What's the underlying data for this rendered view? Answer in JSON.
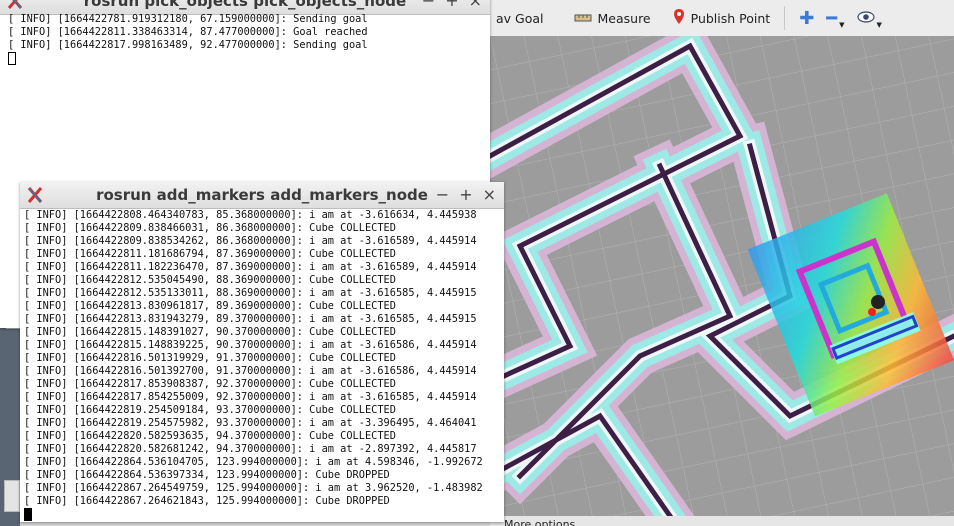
{
  "rviz": {
    "toolbar": [
      {
        "label": "av Goal",
        "icon": "nav-goal-icon"
      },
      {
        "label": "Measure",
        "icon": "ruler-icon"
      },
      {
        "label": "Publish Point",
        "icon": "map-pin-icon"
      }
    ],
    "status_text": "More options"
  },
  "term1": {
    "title": "rosrun pick_objects pick_objects_node",
    "lines": [
      "[ INFO] [1664422781.919312180, 67.159000000]: Sending goal",
      "[ INFO] [1664422811.338463314, 87.477000000]: Goal reached",
      "[ INFO] [1664422817.998163489, 92.477000000]: Sending goal"
    ]
  },
  "term2": {
    "title": "rosrun add_markers add_markers_node",
    "lines": [
      "[ INFO] [1664422808.464340783, 85.368000000]: i am at -3.616634, 4.445938",
      "[ INFO] [1664422809.838466031, 86.368000000]: Cube COLLECTED",
      "[ INFO] [1664422809.838534262, 86.368000000]: i am at -3.616589, 4.445914",
      "[ INFO] [1664422811.181686794, 87.369000000]: Cube COLLECTED",
      "[ INFO] [1664422811.182236470, 87.369000000]: i am at -3.616589, 4.445914",
      "[ INFO] [1664422812.535045490, 88.369000000]: Cube COLLECTED",
      "[ INFO] [1664422812.535133011, 88.369000000]: i am at -3.616585, 4.445915",
      "[ INFO] [1664422813.830961817, 89.369000000]: Cube COLLECTED",
      "[ INFO] [1664422813.831943279, 89.370000000]: i am at -3.616585, 4.445915",
      "[ INFO] [1664422815.148391027, 90.370000000]: Cube COLLECTED",
      "[ INFO] [1664422815.148839225, 90.370000000]: i am at -3.616586, 4.445914",
      "[ INFO] [1664422816.501319929, 91.370000000]: Cube COLLECTED",
      "[ INFO] [1664422816.501392700, 91.370000000]: i am at -3.616586, 4.445914",
      "[ INFO] [1664422817.853908387, 92.370000000]: Cube COLLECTED",
      "[ INFO] [1664422817.854255009, 92.370000000]: i am at -3.616585, 4.445914",
      "[ INFO] [1664422819.254509184, 93.370000000]: Cube COLLECTED",
      "[ INFO] [1664422819.254575982, 93.370000000]: i am at -3.396495, 4.464041",
      "[ INFO] [1664422820.582593635, 94.370000000]: Cube COLLECTED",
      "[ INFO] [1664422820.582681242, 94.370000000]: i am at -2.897392, 4.445817",
      "[ INFO] [1664422864.536104705, 123.994000000]: i am at 4.598346, -1.992672",
      "[ INFO] [1664422864.536397334, 123.994000000]: Cube DROPPED",
      "[ INFO] [1664422867.264549759, 125.994000000]: i am at 3.962520, -1.483982",
      "[ INFO] [1664422867.264621843, 125.994000000]: Cube DROPPED"
    ]
  },
  "window_buttons": {
    "minimize": "−",
    "maximize": "+",
    "close": "×"
  }
}
